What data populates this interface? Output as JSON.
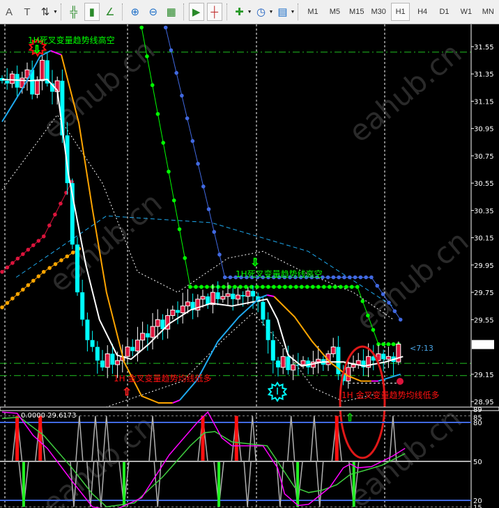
{
  "toolbar": {
    "buttons": [
      {
        "name": "text-label-icon",
        "glyph": "A"
      },
      {
        "name": "text-box-icon",
        "glyph": "T"
      },
      {
        "name": "arrows-icon",
        "glyph": "⇅"
      },
      {
        "name": "bar-chart-icon",
        "glyph": "╬"
      },
      {
        "name": "candlestick-icon",
        "glyph": "▮"
      },
      {
        "name": "line-chart-icon",
        "glyph": "∠"
      },
      {
        "name": "zoom-in-icon",
        "glyph": "⊕"
      },
      {
        "name": "zoom-out-icon",
        "glyph": "⊖"
      },
      {
        "name": "tile-windows-icon",
        "glyph": "▦"
      },
      {
        "name": "autoscroll-icon",
        "glyph": "▶"
      },
      {
        "name": "chart-shift-icon",
        "glyph": "┼"
      },
      {
        "name": "indicators-icon",
        "glyph": "✚"
      },
      {
        "name": "periods-clock-icon",
        "glyph": "◷"
      },
      {
        "name": "templates-icon",
        "glyph": "▤"
      }
    ],
    "timeframes": [
      "M1",
      "M5",
      "M15",
      "M30",
      "H1",
      "H4",
      "D1",
      "W1",
      "MN"
    ],
    "active_timeframe": "H1"
  },
  "colors": {
    "bull": "#dc143c",
    "bear": "#00ffff",
    "ma_white": "#ffffff",
    "ma_orange": "#ffa500",
    "ma_blue": "#1eaaf0",
    "ma_magenta": "#ff00ff",
    "green": "#00ff00",
    "blue_dots": "#4169e1",
    "grid": "#ffffff",
    "level_line": "#4169e1",
    "accent_red": "#ff0000"
  },
  "chart_data": {
    "type": "candlestick",
    "price_axis": {
      "ticks": [
        "31.55",
        "31.35",
        "31.15",
        "30.95",
        "30.75",
        "30.55",
        "30.35",
        "30.15",
        "29.95",
        "29.75",
        "29.55",
        "29.15",
        "28.95"
      ],
      "range": [
        28.9,
        31.7
      ],
      "current_price": "29.37"
    },
    "closes": [
      31.3,
      31.28,
      31.35,
      31.25,
      31.32,
      31.38,
      31.2,
      31.3,
      31.45,
      31.28,
      31.22,
      31.3,
      30.9,
      30.55,
      30.1,
      29.75,
      29.55,
      29.4,
      29.35,
      29.25,
      29.2,
      29.3,
      29.22,
      29.25,
      29.28,
      29.35,
      29.32,
      29.4,
      29.45,
      29.42,
      29.5,
      29.55,
      29.48,
      29.58,
      29.62,
      29.6,
      29.65,
      29.68,
      29.62,
      29.7,
      29.72,
      29.66,
      29.75,
      29.7,
      29.72,
      29.74,
      29.7,
      29.73,
      29.72,
      29.76,
      29.72,
      29.68,
      29.55,
      29.4,
      29.25,
      29.2,
      29.28,
      29.18,
      29.22,
      29.22,
      29.25,
      29.2,
      29.24,
      29.26,
      29.22,
      29.3,
      29.35,
      29.15,
      29.1,
      29.2,
      29.22,
      29.25,
      29.2,
      29.28,
      29.25,
      29.3,
      29.26,
      29.28,
      29.24,
      29.37
    ],
    "ma_white": [
      [
        0,
        31.31
      ],
      [
        5.6,
        31.3
      ],
      [
        9,
        31.31
      ],
      [
        11,
        31.23
      ],
      [
        13.2,
        30.62
      ],
      [
        16.7,
        29.95
      ],
      [
        19.4,
        29.55
      ],
      [
        22.9,
        29.29
      ],
      [
        25.7,
        29.26
      ],
      [
        29.2,
        29.37
      ],
      [
        33.3,
        29.52
      ],
      [
        37.5,
        29.62
      ],
      [
        41.7,
        29.67
      ],
      [
        45.8,
        29.65
      ],
      [
        48.6,
        29.67
      ],
      [
        52.8,
        29.7
      ],
      [
        54.9,
        29.55
      ],
      [
        57,
        29.29
      ],
      [
        59.7,
        29.21
      ],
      [
        63.9,
        29.24
      ],
      [
        68,
        29.24
      ],
      [
        72.2,
        29.21
      ],
      [
        76.4,
        29.24
      ],
      [
        79.9,
        29.28
      ]
    ],
    "ma_trend_segments": [
      {
        "color": "ma_blue",
        "points": [
          [
            0,
            31.0
          ],
          [
            4.2,
            31.25
          ],
          [
            7.6,
            31.48
          ],
          [
            9.7,
            31.52
          ]
        ]
      },
      {
        "color": "ma_magenta",
        "points": [
          [
            9.7,
            31.52
          ],
          [
            11.8,
            31.49
          ]
        ]
      },
      {
        "color": "ma_orange",
        "points": [
          [
            11.8,
            31.49
          ],
          [
            15.3,
            30.99
          ],
          [
            18,
            30.36
          ],
          [
            20.8,
            29.75
          ],
          [
            24.3,
            29.24
          ],
          [
            27.8,
            28.99
          ],
          [
            31.2,
            28.94
          ],
          [
            34,
            28.94
          ]
        ]
      },
      {
        "color": "ma_magenta",
        "points": [
          [
            34,
            28.94
          ],
          [
            35.4,
            28.96
          ]
        ]
      },
      {
        "color": "ma_blue",
        "points": [
          [
            35.4,
            28.96
          ],
          [
            38.9,
            29.11
          ],
          [
            43,
            29.39
          ],
          [
            47.2,
            29.57
          ],
          [
            51.4,
            29.71
          ],
          [
            52.8,
            29.73
          ]
        ]
      },
      {
        "color": "ma_magenta",
        "points": [
          [
            52.8,
            29.73
          ],
          [
            54.2,
            29.72
          ]
        ]
      },
      {
        "color": "ma_orange",
        "points": [
          [
            54.2,
            29.72
          ],
          [
            58.3,
            29.57
          ],
          [
            61.8,
            29.39
          ],
          [
            65.3,
            29.24
          ],
          [
            68.8,
            29.14
          ],
          [
            71.5,
            29.1
          ],
          [
            73.6,
            29.1
          ]
        ]
      },
      {
        "color": "ma_magenta",
        "points": [
          [
            73.6,
            29.1
          ],
          [
            75,
            29.1
          ]
        ]
      },
      {
        "color": "ma_blue",
        "points": [
          [
            75,
            29.1
          ],
          [
            79.4,
            29.15
          ]
        ]
      }
    ],
    "dotted_series": [
      {
        "name": "green-stop-dots",
        "color": "green",
        "points": [
          [
            27.8,
            31.69
          ],
          [
            37.5,
            29.79
          ],
          [
            70.8,
            29.79
          ],
          [
            75,
            29.37
          ],
          [
            79,
            29.37
          ]
        ]
      },
      {
        "name": "blue-stop-dots",
        "color": "blue_dots",
        "points": [
          [
            32.6,
            31.69
          ],
          [
            44.4,
            29.86
          ],
          [
            73.6,
            29.86
          ],
          [
            79.4,
            29.55
          ]
        ]
      },
      {
        "name": "red-stop-dots",
        "color": "bull",
        "points": [
          [
            0,
            29.9
          ],
          [
            8.3,
            30.16
          ],
          [
            13.9,
            30.56
          ]
        ]
      },
      {
        "name": "orange-stop-dots",
        "color": "ma_orange",
        "points": [
          [
            0,
            29.64
          ],
          [
            8.3,
            29.9
          ],
          [
            15.3,
            30.07
          ]
        ]
      }
    ],
    "dashed_series": [
      {
        "name": "blue-dashed-band",
        "color": "ma_blue",
        "points": [
          [
            2.8,
            29.86
          ],
          [
            20.8,
            30.31
          ],
          [
            41.7,
            30.26
          ],
          [
            61,
            30.05
          ],
          [
            77.8,
            29.65
          ]
        ]
      },
      {
        "name": "upper-envelope",
        "color": "ma_white",
        "points": [
          [
            0,
            30.5
          ],
          [
            11,
            31.05
          ],
          [
            20,
            30.55
          ],
          [
            27,
            29.9
          ],
          [
            35,
            29.75
          ],
          [
            45,
            30.0
          ],
          [
            52,
            30.05
          ],
          [
            60,
            29.9
          ],
          [
            70,
            29.75
          ],
          [
            78,
            29.55
          ]
        ]
      },
      {
        "name": "lower-envelope",
        "color": "ma_white",
        "points": [
          [
            20,
            28.9
          ],
          [
            28,
            29.0
          ],
          [
            36,
            29.1
          ],
          [
            44,
            29.4
          ],
          [
            50,
            29.6
          ],
          [
            55,
            29.4
          ],
          [
            62,
            29.05
          ],
          [
            68,
            28.95
          ],
          [
            74,
            29.0
          ]
        ]
      }
    ],
    "horizontal_levels": [
      31.51,
      29.23,
      29.14
    ],
    "annotations": {
      "sell_signal": "1H死叉变量趋势线高空",
      "buy_signal": "1H 金叉变量趋势均线低多",
      "bar_timer": "<7:13"
    },
    "oscillator": {
      "label": "0.0000 29.6173",
      "level_ticks": [
        "89",
        "85",
        "80",
        "50",
        "20",
        "15"
      ],
      "levels": [
        80,
        50,
        20
      ],
      "red_bars": [
        3,
        7.6,
        40,
        46.7,
        66.7
      ],
      "green_bars": [
        4.3,
        24.3,
        43.2,
        58.9,
        70.1
      ],
      "spikes_up": [
        15.4,
        18.6,
        20.8,
        30,
        49.9,
        57.6,
        62.2,
        77.9
      ],
      "spikes_down": [
        14.3,
        17.6,
        19.7,
        31,
        48.9,
        55.4,
        63.3
      ],
      "magenta": [
        [
          0,
          88
        ],
        [
          3,
          87
        ],
        [
          6.2,
          70
        ],
        [
          9,
          60
        ],
        [
          13.9,
          35
        ],
        [
          18,
          15
        ],
        [
          22.2,
          12
        ],
        [
          27.8,
          22
        ],
        [
          33.3,
          55
        ],
        [
          38.9,
          80
        ],
        [
          41,
          88
        ],
        [
          43.8,
          68
        ],
        [
          45.8,
          62
        ],
        [
          52,
          62
        ],
        [
          54.9,
          45
        ],
        [
          56.3,
          25
        ],
        [
          59,
          16
        ],
        [
          61.1,
          17
        ],
        [
          65.3,
          30
        ],
        [
          68,
          45
        ],
        [
          69.4,
          48
        ],
        [
          70.8,
          45
        ],
        [
          73.6,
          46
        ],
        [
          77.8,
          54
        ],
        [
          80.3,
          60
        ]
      ],
      "green": [
        [
          0,
          83
        ],
        [
          3.5,
          84
        ],
        [
          8.3,
          70
        ],
        [
          13.9,
          45
        ],
        [
          18,
          25
        ],
        [
          20.8,
          15
        ],
        [
          26.4,
          18
        ],
        [
          32,
          38
        ],
        [
          37.5,
          62
        ],
        [
          40.3,
          72
        ],
        [
          42.4,
          73
        ],
        [
          45.8,
          65
        ],
        [
          52.8,
          62
        ],
        [
          54.9,
          50
        ],
        [
          58.3,
          30
        ],
        [
          61.1,
          26
        ],
        [
          63.9,
          28
        ],
        [
          66.7,
          32
        ],
        [
          69.4,
          40
        ],
        [
          72.2,
          43
        ],
        [
          75.7,
          47
        ],
        [
          80.3,
          56
        ]
      ]
    }
  }
}
